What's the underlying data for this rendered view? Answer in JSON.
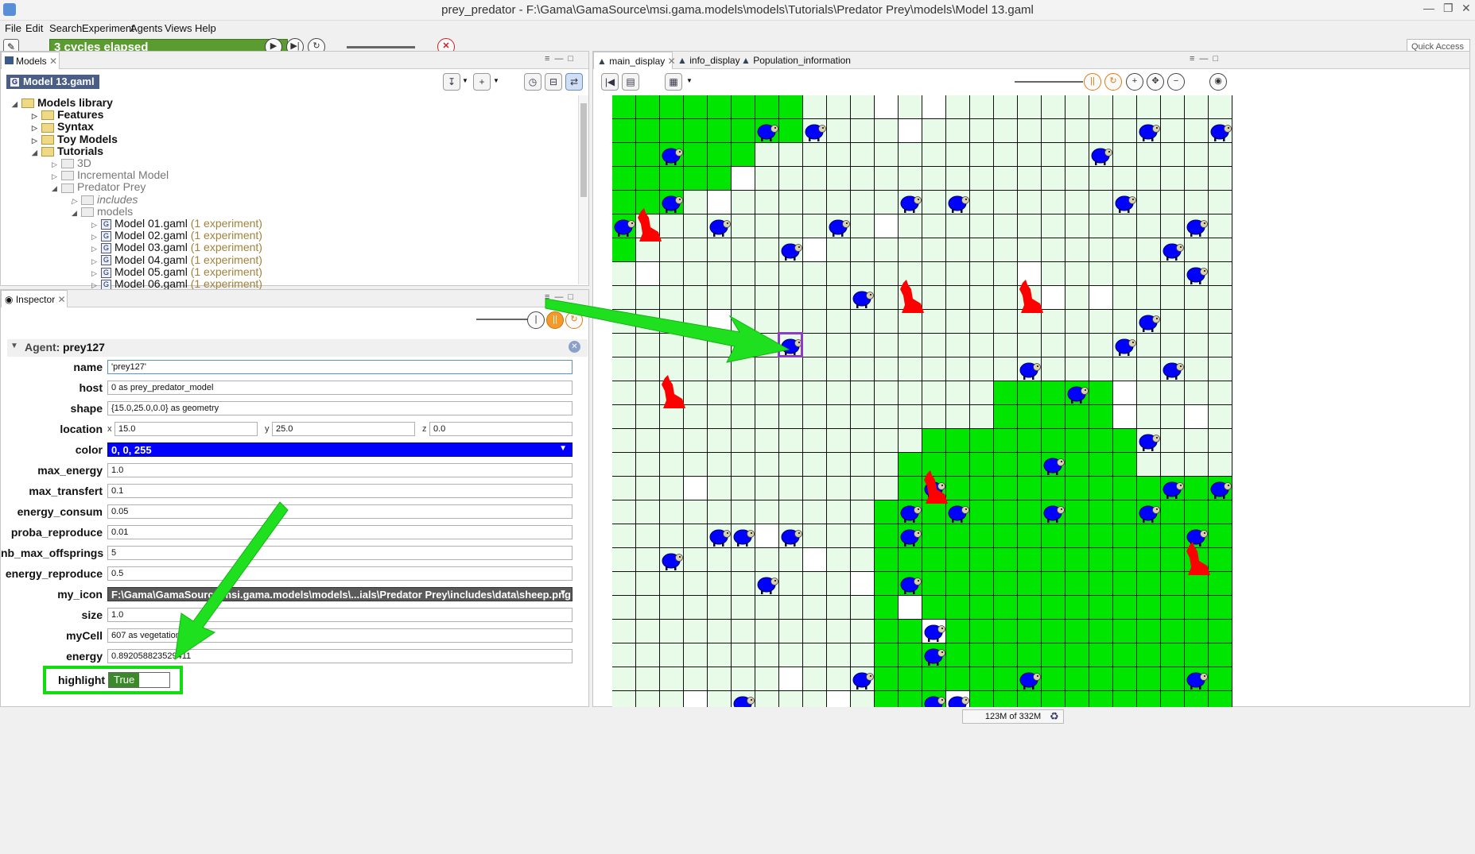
{
  "window": {
    "title": "prey_predator - F:\\Gama\\GamaSource\\msi.gama.models\\models\\Tutorials\\Predator Prey\\models\\Model 13.gaml"
  },
  "menu": [
    "File",
    "Edit",
    "Search",
    "Experiment",
    "Agents",
    "Views",
    "Help"
  ],
  "toolbar": {
    "cycles": "3 cycles elapsed",
    "quick_access": "Quick Access"
  },
  "models_view": {
    "tab": "Models",
    "current_file": "Model 13.gaml",
    "tree": [
      {
        "label": "Models library",
        "level": 0,
        "exp": ""
      },
      {
        "label": "Features",
        "level": 1,
        "exp": ""
      },
      {
        "label": "Syntax",
        "level": 1,
        "exp": ""
      },
      {
        "label": "Toy Models",
        "level": 1,
        "exp": ""
      },
      {
        "label": "Tutorials",
        "level": 1,
        "exp": ""
      },
      {
        "label": "3D",
        "level": 2,
        "exp": ""
      },
      {
        "label": "Incremental Model",
        "level": 2,
        "exp": ""
      },
      {
        "label": "Predator Prey",
        "level": 2,
        "exp": ""
      },
      {
        "label": "includes",
        "level": 3,
        "exp": ""
      },
      {
        "label": "models",
        "level": 3,
        "exp": ""
      },
      {
        "label": "Model 01.gaml",
        "level": 4,
        "exp": "(1 experiment)"
      },
      {
        "label": "Model 02.gaml",
        "level": 4,
        "exp": "(1 experiment)"
      },
      {
        "label": "Model 03.gaml",
        "level": 4,
        "exp": "(1 experiment)"
      },
      {
        "label": "Model 04.gaml",
        "level": 4,
        "exp": "(1 experiment)"
      },
      {
        "label": "Model 05.gaml",
        "level": 4,
        "exp": "(1 experiment)"
      },
      {
        "label": "Model 06.gaml",
        "level": 4,
        "exp": "(1 experiment)"
      }
    ]
  },
  "inspector": {
    "tab": "Inspector",
    "agent_label": "Agent:",
    "agent_name": "prey127",
    "fields": {
      "name": {
        "label": "name",
        "value": "'prey127'"
      },
      "host": {
        "label": "host",
        "value": "0 as prey_predator_model"
      },
      "shape": {
        "label": "shape",
        "value": "{15.0,25.0,0.0} as geometry"
      },
      "location": {
        "label": "location",
        "x": "15.0",
        "y": "25.0",
        "z": "0.0",
        "x_label": "x",
        "y_label": "y",
        "z_label": "z"
      },
      "color": {
        "label": "color",
        "value": "0, 0, 255"
      },
      "max_energy": {
        "label": "max_energy",
        "value": "1.0"
      },
      "max_transfert": {
        "label": "max_transfert",
        "value": "0.1"
      },
      "energy_consum": {
        "label": "energy_consum",
        "value": "0.05"
      },
      "proba_reproduce": {
        "label": "proba_reproduce",
        "value": "0.01"
      },
      "nb_max_offsprings": {
        "label": "nb_max_offsprings",
        "value": "5"
      },
      "energy_reproduce": {
        "label": "energy_reproduce",
        "value": "0.5"
      },
      "my_icon": {
        "label": "my_icon",
        "value": "F:\\Gama\\GamaSource\\msi.gama.models\\models\\...ials\\Predator Prey\\includes\\data\\sheep.png"
      },
      "size": {
        "label": "size",
        "value": "1.0"
      },
      "myCell": {
        "label": "myCell",
        "value": "607 as vegetation_"
      },
      "energy": {
        "label": "energy",
        "value": "0.892058823529411"
      },
      "highlight": {
        "label": "highlight",
        "value": "True"
      }
    }
  },
  "display": {
    "tabs": [
      "main_display",
      "info_display",
      "Population_information"
    ]
  },
  "status": {
    "memory": "123M of 332M"
  },
  "colors": {
    "prey": "#0000ff",
    "predator": "#ff0000",
    "cell_light": "#e8fbe8",
    "cell_green": "#00e600",
    "highlight_arrow": "#1fe01f"
  }
}
